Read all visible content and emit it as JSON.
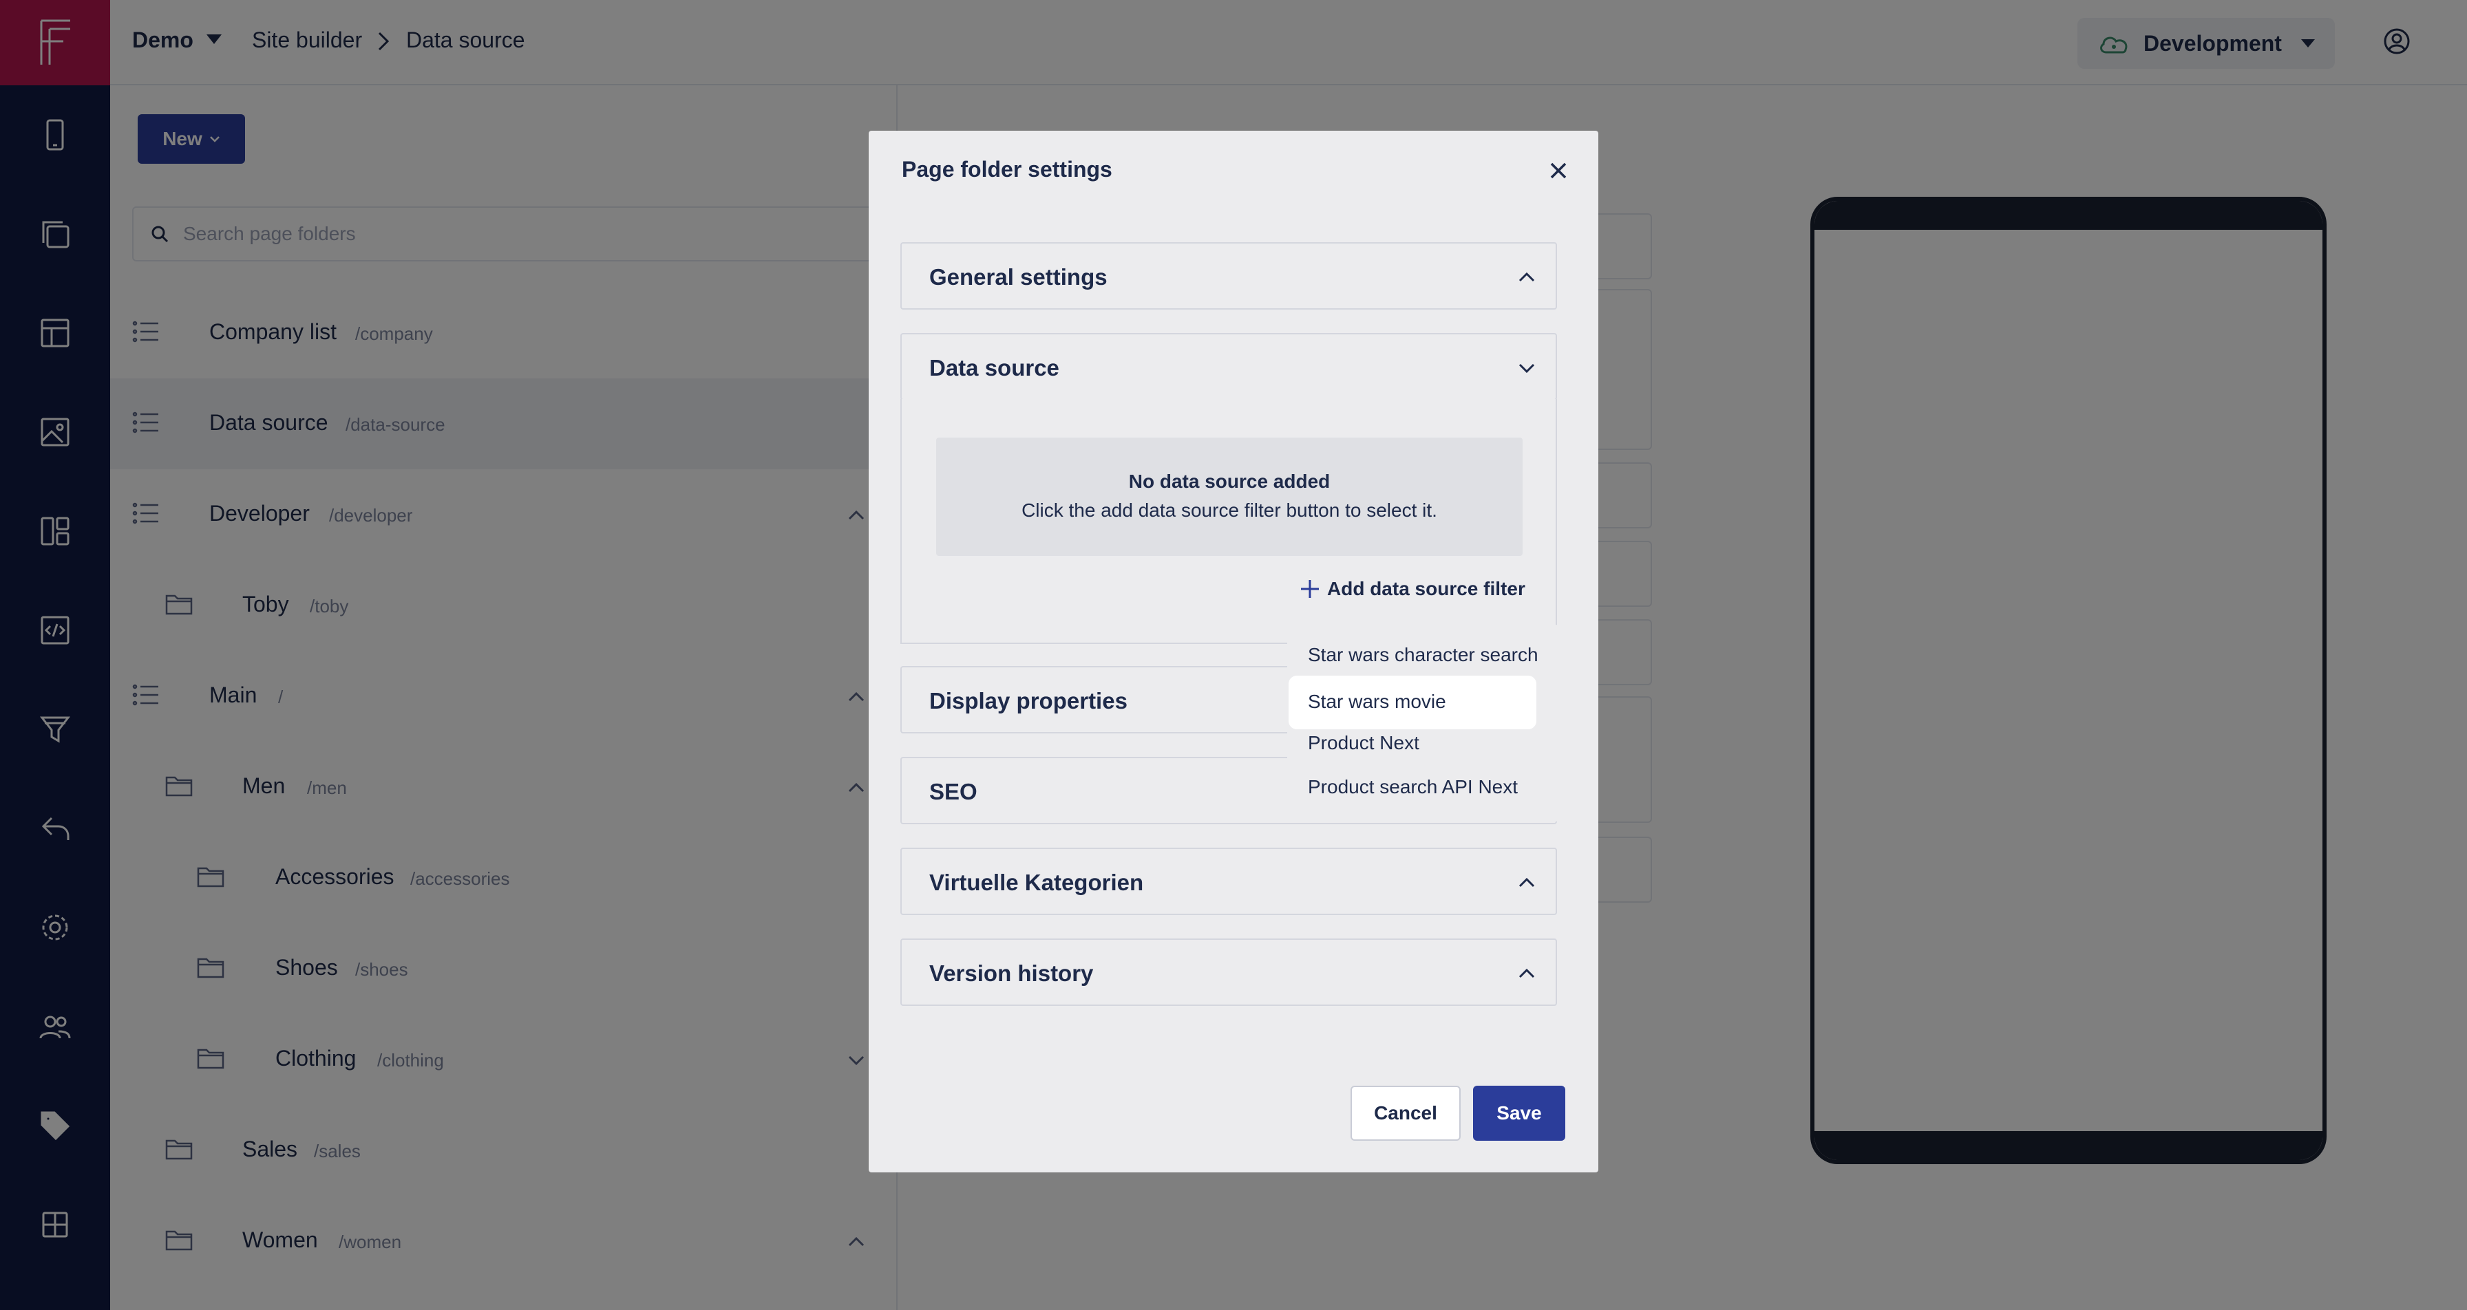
{
  "topbar": {
    "project": "Demo",
    "breadcrumb": [
      "Site builder",
      "Data source"
    ],
    "environment": "Development"
  },
  "panel": {
    "new_label": "New",
    "search_placeholder": "Search page folders",
    "tree": [
      {
        "name": "Company list",
        "path": "/company",
        "icon": "list-icon"
      },
      {
        "name": "Data source",
        "path": "/data-source",
        "icon": "list-icon",
        "selected": true
      },
      {
        "name": "Developer",
        "path": "/developer",
        "icon": "list-icon",
        "expanded": true
      },
      {
        "name": "Toby",
        "path": "/toby",
        "icon": "folder-icon"
      },
      {
        "name": "Main",
        "path": "/",
        "icon": "list-icon",
        "expanded": true
      },
      {
        "name": "Men",
        "path": "/men",
        "icon": "folder-icon",
        "expanded": true
      },
      {
        "name": "Accessories",
        "path": "/accessories",
        "icon": "folder-icon"
      },
      {
        "name": "Shoes",
        "path": "/shoes",
        "icon": "folder-icon"
      },
      {
        "name": "Clothing",
        "path": "/clothing",
        "icon": "folder-icon",
        "expanded": false
      },
      {
        "name": "Sales",
        "path": "/sales",
        "icon": "folder-icon"
      },
      {
        "name": "Women",
        "path": "/women",
        "icon": "folder-icon",
        "expanded": true
      }
    ]
  },
  "modal": {
    "title": "Page folder settings",
    "sections": {
      "general": "General settings",
      "data_source": "Data source",
      "display": "Display properties",
      "seo": "SEO",
      "virtual": "Virtuelle Kategorien",
      "version": "Version history"
    },
    "empty_title": "No data source added",
    "empty_text": "Click the add data source filter button to select it.",
    "add_filter_label": "Add data source filter",
    "dropdown_options": [
      "Star wars character search",
      "Star wars movie",
      "Product Next",
      "Product search API Next"
    ],
    "highlighted_option": "Star wars movie",
    "cancel_label": "Cancel",
    "save_label": "Save"
  }
}
